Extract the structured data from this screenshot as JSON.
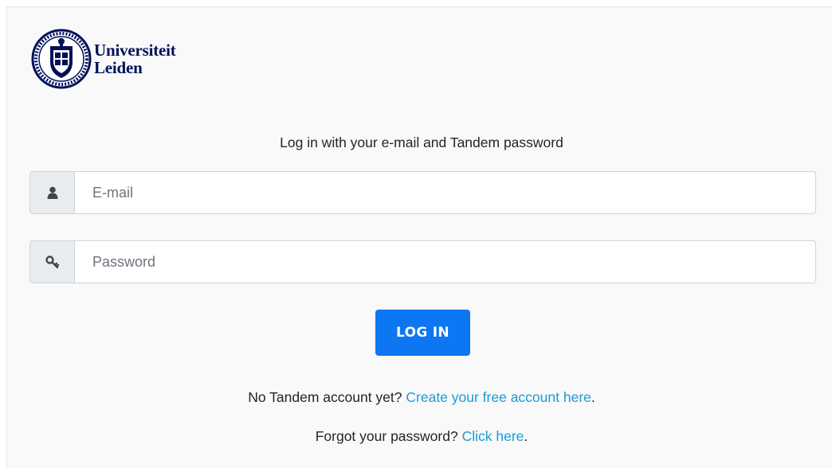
{
  "logo": {
    "line1": "Universiteit",
    "line2": "Leiden",
    "color": "#001158"
  },
  "intro": "Log in with your e-mail and Tandem password",
  "email": {
    "placeholder": "E-mail",
    "value": "",
    "icon": "user-icon"
  },
  "password": {
    "placeholder": "Password",
    "value": "",
    "icon": "key-icon"
  },
  "login_button": {
    "label": "LOG IN",
    "color": "#0d76f2"
  },
  "account_line": {
    "text": "No Tandem account yet?",
    "link": "Create your free account here",
    "suffix": "."
  },
  "forgot_line": {
    "text": "Forgot your password?",
    "link": "Click here",
    "suffix": "."
  },
  "link_color": "#1a9bd7"
}
